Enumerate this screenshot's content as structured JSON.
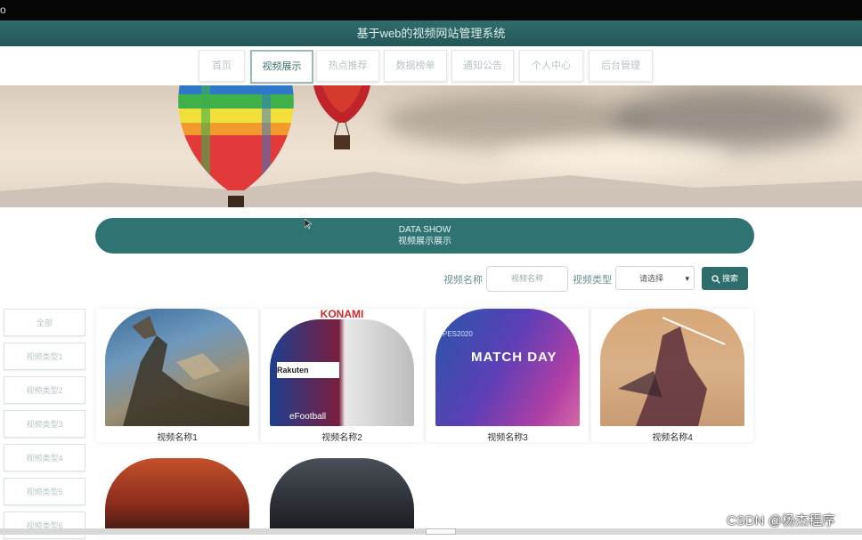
{
  "window": {
    "corner_glyph": "o"
  },
  "header": {
    "title": "基于web的视频网站管理系统"
  },
  "nav": {
    "items": [
      {
        "label": "首页",
        "active": false
      },
      {
        "label": "视频展示",
        "active": true
      },
      {
        "label": "热点推荐",
        "active": false
      },
      {
        "label": "数据榜单",
        "active": false
      },
      {
        "label": "通知公告",
        "active": false
      },
      {
        "label": "个人中心",
        "active": false
      },
      {
        "label": "后台管理",
        "active": false
      }
    ]
  },
  "section": {
    "title_en": "DATA SHOW",
    "title_cn": "视频展示展示"
  },
  "search": {
    "name_label": "视频名称",
    "name_placeholder": "视频名称",
    "type_label": "视频类型",
    "type_selected": "请选择",
    "button_label": "搜索"
  },
  "categories": [
    "全部",
    "视频类型1",
    "视频类型2",
    "视频类型3",
    "视频类型4",
    "视频类型5",
    "视频类型6"
  ],
  "videos": [
    {
      "name": "视频名称1"
    },
    {
      "name": "视频名称2",
      "brand_text": "KONAMI",
      "sub_text": "eFootball",
      "sponsor": "Rakuten"
    },
    {
      "name": "视频名称3",
      "headline": "MATCH DAY",
      "tag": "PES2020"
    },
    {
      "name": "视频名称4"
    },
    {
      "name": ""
    },
    {
      "name": ""
    }
  ],
  "watermark": "CSDN @杨杰程序",
  "colors": {
    "primary": "#2f6d6d",
    "accent_light": "#9fb8b8"
  }
}
